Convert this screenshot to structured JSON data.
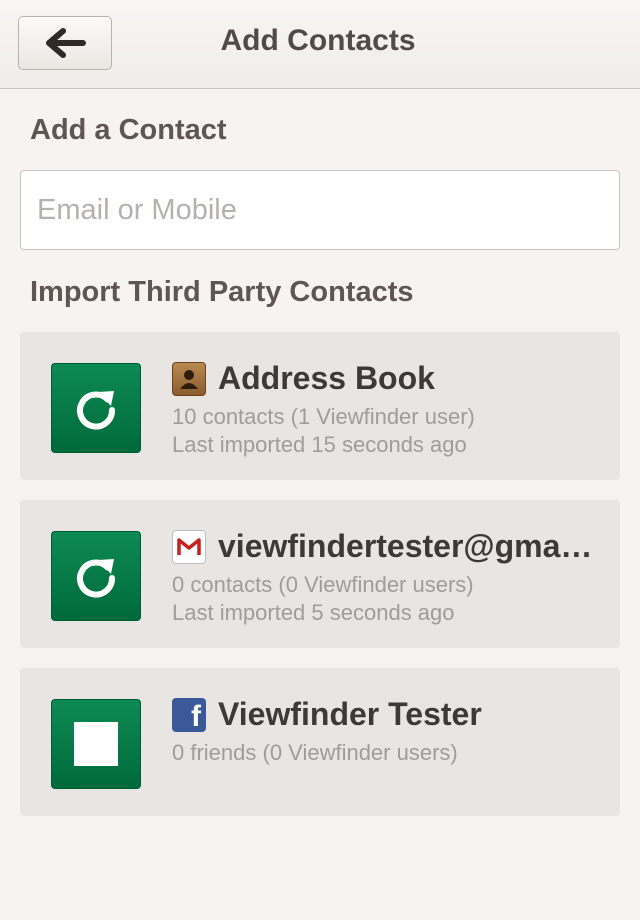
{
  "header": {
    "title": "Add Contacts",
    "back_icon": "arrow-left-icon"
  },
  "add_contact": {
    "title": "Add a Contact",
    "input_placeholder": "Email or Mobile",
    "input_value": ""
  },
  "import": {
    "title": "Import Third Party Contacts",
    "sources": [
      {
        "icon": "address-book-icon",
        "action": "refresh-icon",
        "name": "Address Book",
        "count_text": "10 contacts (1 Viewfinder user)",
        "last_imported": "Last imported 15 seconds ago"
      },
      {
        "icon": "gmail-icon",
        "action": "refresh-icon",
        "name": "viewfindertester@gmail.com",
        "count_text": "0 contacts (0 Viewfinder users)",
        "last_imported": "Last imported 5 seconds ago"
      },
      {
        "icon": "facebook-icon",
        "action": "stop-icon",
        "name": "Viewfinder Tester",
        "count_text": "0 friends (0 Viewfinder users)",
        "last_imported": ""
      }
    ]
  },
  "colors": {
    "accent_green": "#007a45",
    "background": "#f6f3f0",
    "card": "#e8e5e2",
    "facebook_blue": "#3b5998",
    "gmail_red": "#c5221f"
  }
}
